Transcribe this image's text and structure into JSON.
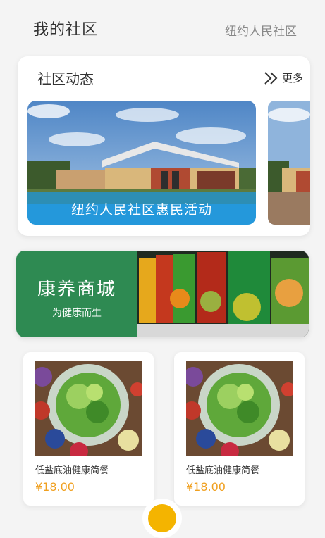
{
  "header": {
    "title": "我的社区",
    "community": "纽约人民社区"
  },
  "news": {
    "title": "社区动态",
    "more_label": "更多",
    "banner_caption": "纽约人民社区惠民活动"
  },
  "mall": {
    "title": "康养商城",
    "subtitle": "为健康而生",
    "brand_color": "#2e8a52"
  },
  "products": [
    {
      "name": "低盐底油健康简餐",
      "price": "¥18.00"
    },
    {
      "name": "低盐底油健康简餐",
      "price": "¥18.00"
    }
  ],
  "colors": {
    "price": "#f0a020",
    "caption_bg": "#1e96dc",
    "fab": "#f4b400"
  },
  "icons": {
    "more": "double-chevron-right-icon"
  }
}
